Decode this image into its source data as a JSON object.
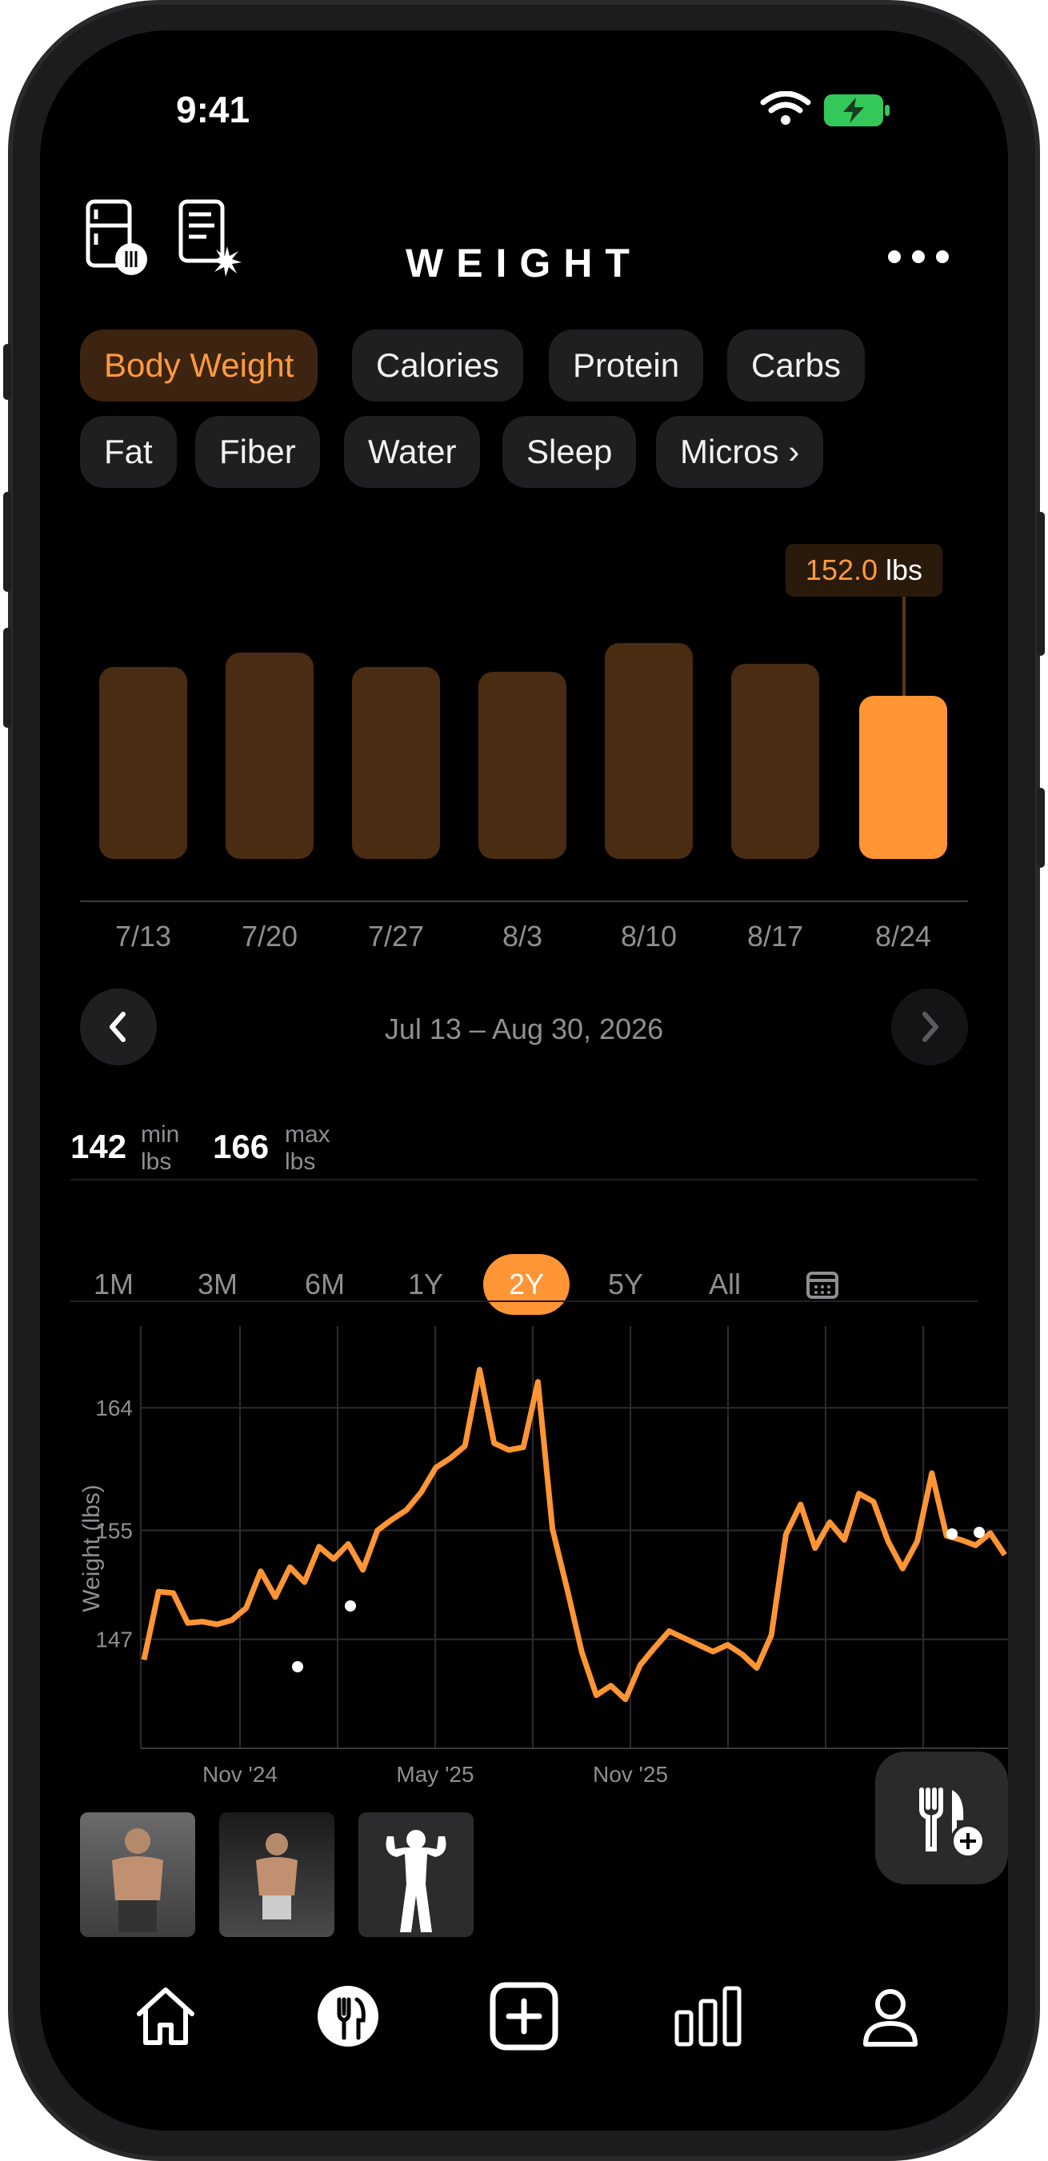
{
  "status": {
    "time": "9:41"
  },
  "header": {
    "title": "WEIGHT"
  },
  "chips": [
    "Body Weight",
    "Calories",
    "Protein",
    "Carbs",
    "Fat",
    "Fiber",
    "Water",
    "Sleep",
    "Micros ›"
  ],
  "bar_chart": {
    "tooltip_value": "152.0",
    "tooltip_unit": "lbs",
    "labels": [
      "7/13",
      "7/20",
      "7/27",
      "8/3",
      "8/10",
      "8/17",
      "8/24"
    ],
    "date_range": "Jul 13 – Aug 30, 2026"
  },
  "stats": {
    "min_value": "142",
    "min_label": "min",
    "max_value": "166",
    "max_label": "max",
    "unit": "lbs"
  },
  "periods": [
    "1M",
    "3M",
    "6M",
    "1Y",
    "2Y",
    "5Y",
    "All"
  ],
  "selected_period": "2Y",
  "chart_data": {
    "type": "line",
    "ylabel": "Weight (lbs)",
    "yticks": [
      "164",
      "155",
      "147"
    ],
    "xticks": [
      "Nov '24",
      "May '25",
      "Nov '25"
    ],
    "ylim": [
      139,
      170
    ],
    "series": [
      {
        "values": [
          145.5,
          150.5,
          150.4,
          148.2,
          148.3,
          148.1,
          148.4,
          149.3,
          152.0,
          150.1,
          152.3,
          151.2,
          153.8,
          152.9,
          154.0,
          152.1,
          155.0,
          155.8,
          156.5,
          157.8,
          159.6,
          160.3,
          161.2,
          166.8,
          161.4,
          160.9,
          161.1,
          165.9,
          155.1,
          150.7,
          146.1,
          142.9,
          143.6,
          142.6,
          145.1,
          146.4,
          147.6,
          147.1,
          146.6,
          146.1,
          146.6,
          145.9,
          144.9,
          147.3,
          154.7,
          156.9,
          153.7,
          155.6,
          154.3,
          157.7,
          157.1,
          154.2,
          152.2,
          154.2,
          159.2,
          154.6,
          154.3,
          153.9,
          154.8,
          153.2
        ]
      }
    ],
    "colors": {
      "line": "#ff9534",
      "grid": "#2c2c2e"
    }
  },
  "bottom_nav": [
    "home",
    "food",
    "add",
    "stats",
    "profile"
  ]
}
